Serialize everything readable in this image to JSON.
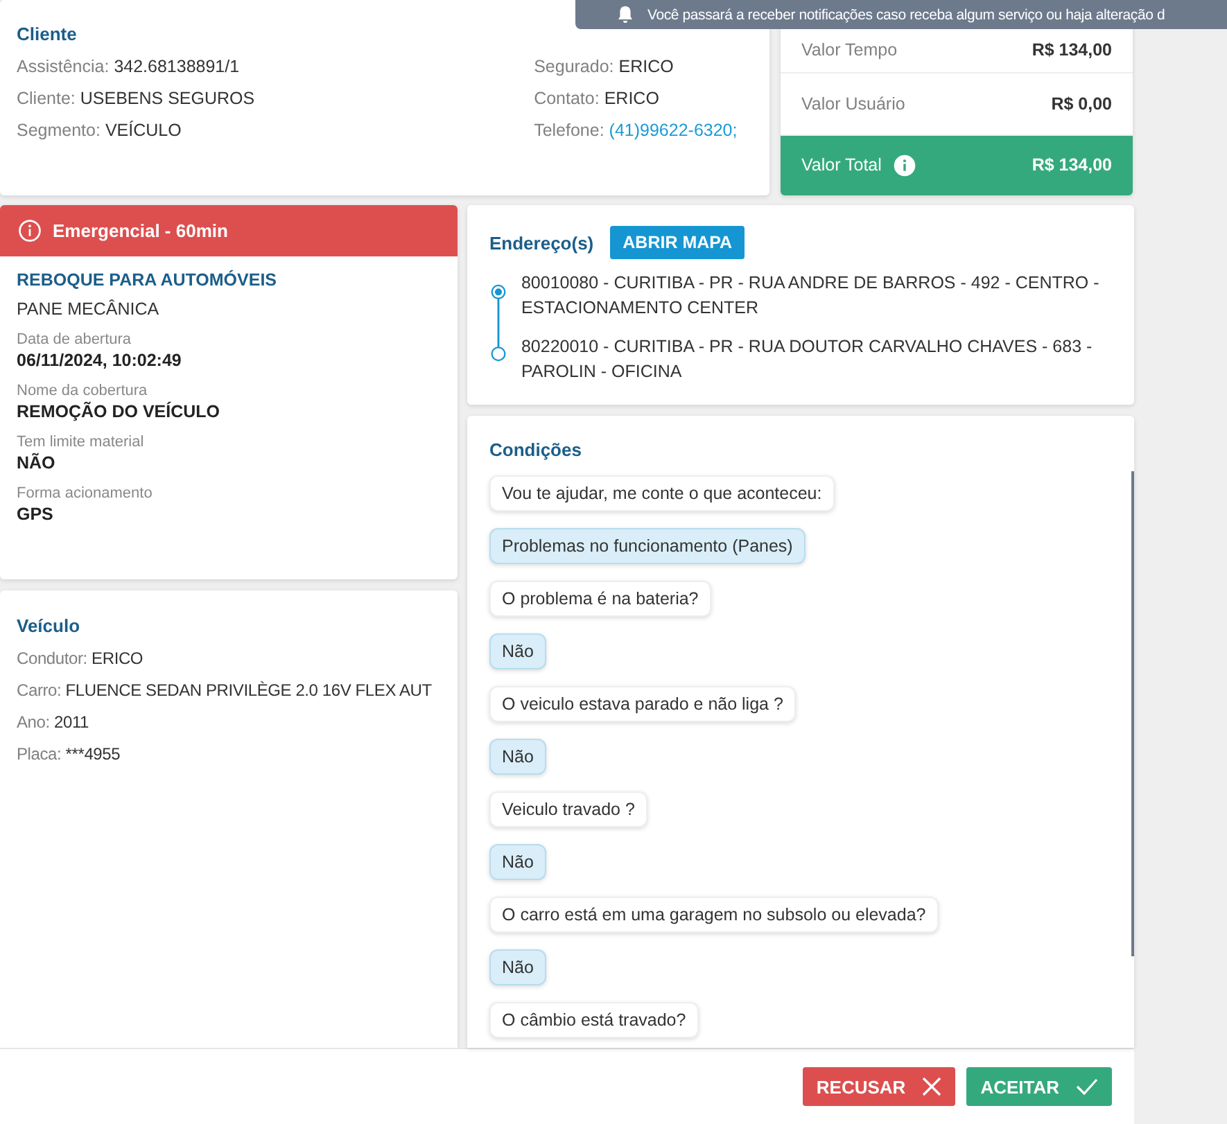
{
  "notification": {
    "text": "Você passará a receber notificações caso receba algum serviço ou haja alteração d"
  },
  "client": {
    "title": "Cliente",
    "left": [
      {
        "label": "Assistência:",
        "value": "342.68138891/1"
      },
      {
        "label": "Cliente:",
        "value": "USEBENS SEGUROS"
      },
      {
        "label": "Segmento:",
        "value": "VEÍCULO"
      }
    ],
    "right": [
      {
        "label": "Segurado:",
        "value": "ERICO",
        "kind": "text"
      },
      {
        "label": "Contato:",
        "value": "ERICO",
        "kind": "text"
      },
      {
        "label": "Telefone:",
        "value": "(41)99622-6320;",
        "kind": "link"
      }
    ]
  },
  "values": [
    {
      "label": "Valor Tempo",
      "amount": "R$ 134,00",
      "kind": "plain"
    },
    {
      "label": "Valor Usuário",
      "amount": "R$ 0,00",
      "kind": "plain"
    },
    {
      "label": "Valor Total",
      "amount": "R$ 134,00",
      "kind": "total"
    }
  ],
  "service": {
    "priority": "Emergencial - 60min",
    "title": "REBOQUE PARA AUTOMÓVEIS",
    "subtitle": "PANE MECÂNICA",
    "fields": [
      {
        "label": "Data de abertura",
        "value": "06/11/2024, 10:02:49"
      },
      {
        "label": "Nome da cobertura",
        "value": "REMOÇÃO DO VEÍCULO"
      },
      {
        "label": "Tem limite material",
        "value": "NÃO"
      },
      {
        "label": "Forma acionamento",
        "value": "GPS"
      }
    ]
  },
  "vehicle": {
    "title": "Veículo",
    "fields": [
      {
        "label": "Condutor:",
        "value": "ERICO"
      },
      {
        "label": "Carro:",
        "value": "FLUENCE SEDAN PRIVILÈGE 2.0 16V FLEX AUT"
      },
      {
        "label": "Ano:",
        "value": "2011"
      },
      {
        "label": "Placa:",
        "value": "***4955"
      }
    ]
  },
  "addresses": {
    "title": "Endereço(s)",
    "button": "ABRIR MAPA",
    "items": [
      {
        "text": "80010080 - CURITIBA - PR - RUA ANDRE DE BARROS - 492 - CENTRO - ESTACIONAMENTO CENTER",
        "kind": "origin"
      },
      {
        "text": "80220010 - CURITIBA - PR - RUA DOUTOR CARVALHO CHAVES - 683 - PAROLIN - OFICINA",
        "kind": "destination"
      }
    ]
  },
  "conditions": {
    "title": "Condições",
    "messages": [
      {
        "text": "Vou te ajudar, me conte o que aconteceu:",
        "kind": "question"
      },
      {
        "text": "Problemas no funcionamento (Panes)",
        "kind": "answer"
      },
      {
        "text": "O problema é na bateria?",
        "kind": "question"
      },
      {
        "text": "Não",
        "kind": "answer"
      },
      {
        "text": "O veiculo estava parado e não liga ?",
        "kind": "question"
      },
      {
        "text": "Não",
        "kind": "answer"
      },
      {
        "text": "Veiculo travado ?",
        "kind": "question"
      },
      {
        "text": "Não",
        "kind": "answer"
      },
      {
        "text": "O carro está em uma garagem no subsolo ou elevada?",
        "kind": "question"
      },
      {
        "text": "Não",
        "kind": "answer"
      },
      {
        "text": "O câmbio está travado?",
        "kind": "question"
      }
    ]
  },
  "actions": [
    {
      "label": "RECUSAR",
      "kind": "reject"
    },
    {
      "label": "ACEITAR",
      "kind": "accept"
    }
  ]
}
